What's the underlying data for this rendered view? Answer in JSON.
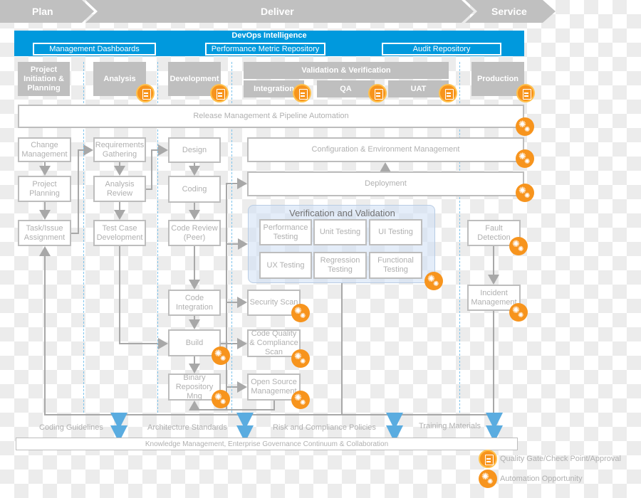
{
  "phases": {
    "plan": "Plan",
    "deliver": "Deliver",
    "service": "Service"
  },
  "intelligence": {
    "title": "DevOps Intelligence",
    "items": [
      "Management Dashboards",
      "Performance Metric Repository",
      "Audit Repository"
    ]
  },
  "stages": {
    "project": "Project Initiation & Planning",
    "analysis": "Analysis",
    "development": "Development",
    "validation": "Validation & Verification",
    "integration": "Integration",
    "qa": "QA",
    "uat": "UAT",
    "production": "Production"
  },
  "release": "Release Management & Pipeline Automation",
  "plan_col": [
    "Change Management",
    "Project Planning",
    "Task/Issue Assignment"
  ],
  "analysis_col": [
    "Requirements Gathering",
    "Analysis Review",
    "Test Case Development"
  ],
  "dev_col": [
    "Design",
    "Coding",
    "Code Review (Peer)",
    "Code Integration",
    "Build",
    "Binary Repository Mng"
  ],
  "scan_col": [
    "Security Scan",
    "Code Quality & Compliance Scan",
    "Open Source Management"
  ],
  "config": "Configuration & Environment Management",
  "deployment": "Deployment",
  "vv": {
    "title": "Verification and Validation",
    "items": [
      "Performance Testing",
      "Unit Testing",
      "UI Testing",
      "UX Testing",
      "Regression Testing",
      "Functional Testing"
    ]
  },
  "service_col": [
    "Fault Detection",
    "Incident Management"
  ],
  "knowledge_inputs": [
    "Coding Guidelines",
    "Architecture Standards",
    "Risk and Compliance Policies",
    "Training Materials"
  ],
  "knowledge": "Knowledge Management, Enterprise Governance Continuum & Collaboration",
  "legend": {
    "gate": "Quality Gate/Check Point/Approval",
    "automation": "Automation Opportunity"
  },
  "colors": {
    "accent": "#0099dd",
    "orange": "#f7941d",
    "phase_gray": "#bfbfbf",
    "arrow_blue": "#5aace0"
  }
}
